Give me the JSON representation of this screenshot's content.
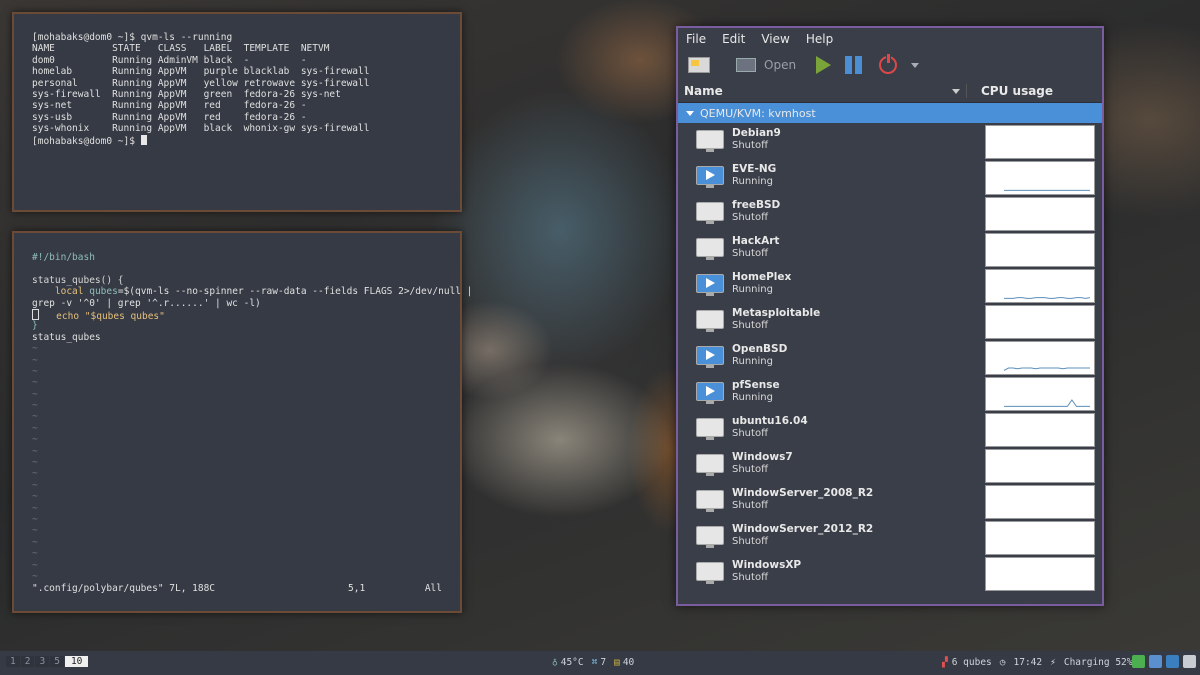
{
  "terminal": {
    "prompt": "[mohabaks@dom0 ~]$ qvm-ls --running",
    "headers": [
      "NAME",
      "STATE",
      "CLASS",
      "LABEL",
      "TEMPLATE",
      "NETVM"
    ],
    "rows": [
      [
        "dom0",
        "Running",
        "AdminVM",
        "black",
        "-",
        "-"
      ],
      [
        "homelab",
        "Running",
        "AppVM",
        "purple",
        "blacklab",
        "sys-firewall"
      ],
      [
        "personal",
        "Running",
        "AppVM",
        "yellow",
        "retrowave",
        "sys-firewall"
      ],
      [
        "sys-firewall",
        "Running",
        "AppVM",
        "green",
        "fedora-26",
        "sys-net"
      ],
      [
        "sys-net",
        "Running",
        "AppVM",
        "red",
        "fedora-26",
        "-"
      ],
      [
        "sys-usb",
        "Running",
        "AppVM",
        "red",
        "fedora-26",
        "-"
      ],
      [
        "sys-whonix",
        "Running",
        "AppVM",
        "black",
        "whonix-gw",
        "sys-firewall"
      ]
    ],
    "final_prompt": "[mohabaks@dom0 ~]$ "
  },
  "vim": {
    "shebang": "#!/bin/bash",
    "fn_decl": "status_qubes() {",
    "local_kw": "local",
    "local_var": "qubes",
    "local_rest": "=$(qvm-ls --no-spinner --raw-data --fields FLAGS 2>/dev/null |",
    "line_wrap": "grep -v '^0' | grep '^.r......' | wc -l)",
    "echo_kw": "echo",
    "echo_str": "\"$qubes qubes\"",
    "close_brace": "}",
    "call": "status_qubes",
    "tilde_count": 21,
    "status_file": "\".config/polybar/qubes\" 7L, 188C",
    "status_pos": "5,1",
    "status_all": "All"
  },
  "virt_manager": {
    "menu": [
      "File",
      "Edit",
      "View",
      "Help"
    ],
    "toolbar": {
      "open_label": "Open"
    },
    "columns": {
      "name": "Name",
      "cpu": "CPU usage"
    },
    "host": "QEMU/KVM: kvmhost",
    "vms": [
      {
        "name": "Debian9",
        "state": "Shutoff",
        "running": false,
        "cpu": []
      },
      {
        "name": "EVE-NG",
        "state": "Running",
        "running": true,
        "cpu": [
          2,
          2,
          2,
          2,
          2,
          2,
          2,
          2,
          2,
          2,
          2,
          2,
          2,
          2,
          2,
          2,
          2,
          2,
          2,
          2
        ]
      },
      {
        "name": "freeBSD",
        "state": "Shutoff",
        "running": false,
        "cpu": []
      },
      {
        "name": "HackArt",
        "state": "Shutoff",
        "running": false,
        "cpu": []
      },
      {
        "name": "HomePlex",
        "state": "Running",
        "running": true,
        "cpu": [
          2,
          2,
          2,
          3,
          3,
          2,
          2,
          3,
          3,
          3,
          2,
          2,
          3,
          3,
          2,
          2,
          3,
          3,
          2,
          3
        ]
      },
      {
        "name": "Metasploitable",
        "state": "Shutoff",
        "running": false,
        "cpu": []
      },
      {
        "name": "OpenBSD",
        "state": "Running",
        "running": true,
        "cpu": [
          2,
          5,
          5,
          4,
          5,
          5,
          5,
          4,
          5,
          5,
          5,
          5,
          5,
          4,
          5,
          5,
          5,
          5,
          5,
          5
        ]
      },
      {
        "name": "pfSense",
        "state": "Running",
        "running": true,
        "cpu": [
          2,
          2,
          2,
          2,
          2,
          2,
          2,
          2,
          2,
          2,
          2,
          2,
          2,
          2,
          2,
          10,
          2,
          2,
          2,
          2
        ]
      },
      {
        "name": "ubuntu16.04",
        "state": "Shutoff",
        "running": false,
        "cpu": []
      },
      {
        "name": "Windows7",
        "state": "Shutoff",
        "running": false,
        "cpu": []
      },
      {
        "name": "WindowServer_2008_R2",
        "state": "Shutoff",
        "running": false,
        "cpu": []
      },
      {
        "name": "WindowServer_2012_R2",
        "state": "Shutoff",
        "running": false,
        "cpu": []
      },
      {
        "name": "WindowsXP",
        "state": "Shutoff",
        "running": false,
        "cpu": []
      }
    ]
  },
  "bar": {
    "workspaces": [
      "1",
      "2",
      "3",
      "5",
      "10"
    ],
    "active_workspace": "10",
    "temp": "45°C",
    "mid1": "7",
    "mid2": "40",
    "qubes": "6 qubes",
    "time": "17:42",
    "battery": "Charging 52%",
    "colors": {
      "accent_green": "#4caf50",
      "qubes_red": "#e05050"
    }
  }
}
